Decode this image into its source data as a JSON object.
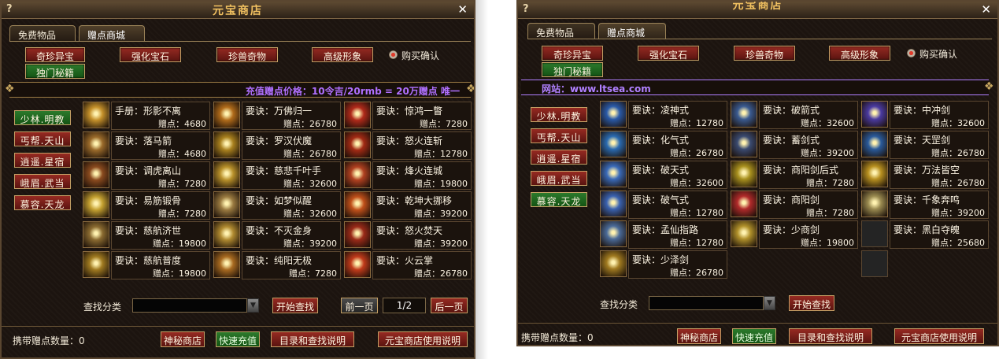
{
  "common": {
    "help_icon": "?",
    "close_icon": "✕",
    "title": "元宝商店",
    "tabs": [
      "免费物品",
      "赠点商城"
    ],
    "categories": [
      "奇珍异宝",
      "强化宝石",
      "珍兽奇物",
      "高级形象",
      "独门秘籍"
    ],
    "confirm_label": "购买确认",
    "sects": [
      "少林.明教",
      "丐帮.天山",
      "逍遥.星宿",
      "峨眉.武当",
      "慕容.天龙"
    ],
    "search_label": "查找分类",
    "search_value": "",
    "search_button": "开始查找",
    "carried_label": "携带赠点数量：0",
    "footer_buttons": [
      "神秘商店",
      "快速充值",
      "目录和查找说明",
      "元宝商店使用说明"
    ]
  },
  "left": {
    "banner": "充值赠点价格：10令吉/20rmb = 20万赠点  唯一",
    "active_sect_index": 0,
    "page_prev": "前一页",
    "page_indicator": "1/2",
    "page_next": "后一页",
    "items": [
      {
        "name": "手册：形影不离",
        "points": "赠点：4680",
        "icon_color": "#c4902a"
      },
      {
        "name": "要诀：万佛归一",
        "points": "赠点：26780",
        "icon_color": "#b06b1a"
      },
      {
        "name": "要诀：惊鸿一瞥",
        "points": "赠点：7280",
        "icon_color": "#b02a1a"
      },
      {
        "name": "要诀：落马箭",
        "points": "赠点：4680",
        "icon_color": "#9a6a2a"
      },
      {
        "name": "要诀：罗汉伏魔",
        "points": "赠点：26780",
        "icon_color": "#a8801e"
      },
      {
        "name": "要诀：怒火连斩",
        "points": "赠点：12780",
        "icon_color": "#a22a14"
      },
      {
        "name": "要诀：调虎离山",
        "points": "赠点：7280",
        "icon_color": "#8a4a1e"
      },
      {
        "name": "要诀：慈悲千叶手",
        "points": "赠点：32600",
        "icon_color": "#b8902a"
      },
      {
        "name": "要诀：烽火连城",
        "points": "赠点：19800",
        "icon_color": "#b04020"
      },
      {
        "name": "要诀：易筋锻骨",
        "points": "赠点：7280",
        "icon_color": "#c4a030"
      },
      {
        "name": "要诀：如梦似醒",
        "points": "赠点：32600",
        "icon_color": "#9a7a40"
      },
      {
        "name": "要诀：乾坤大挪移",
        "points": "赠点：39200",
        "icon_color": "#c0501a"
      },
      {
        "name": "要诀：慈航济世",
        "points": "赠点：19800",
        "icon_color": "#8a6a30"
      },
      {
        "name": "要诀：不灭金身",
        "points": "赠点：39200",
        "icon_color": "#b08a30"
      },
      {
        "name": "要诀：怒火焚天",
        "points": "赠点：39200",
        "icon_color": "#9a2a18"
      },
      {
        "name": "要诀：慈航普度",
        "points": "赠点：19800",
        "icon_color": "#a07a20"
      },
      {
        "name": "要诀：纯阳无极",
        "points": "赠点：7280",
        "icon_color": "#a86a20"
      },
      {
        "name": "要诀：火云掌",
        "points": "赠点：26780",
        "icon_color": "#c03a1a"
      }
    ]
  },
  "right": {
    "banner": "网站：www.ltsea.com",
    "active_sect_index": 4,
    "items": [
      {
        "name": "要诀：凌神式",
        "points": "赠点：12780",
        "icon_color": "#2a5aa8"
      },
      {
        "name": "要诀：破箭式",
        "points": "赠点：32600",
        "icon_color": "#3a5a90"
      },
      {
        "name": "要诀：中冲剑",
        "points": "赠点：32600",
        "icon_color": "#4a3aa0"
      },
      {
        "name": "要诀：化气式",
        "points": "赠点：26780",
        "icon_color": "#2a6ab0"
      },
      {
        "name": "要诀：蓄剑式",
        "points": "赠点：39200",
        "icon_color": "#3a4a70"
      },
      {
        "name": "要诀：天罡剑",
        "points": "赠点：26780",
        "icon_color": "#2a5a9a"
      },
      {
        "name": "要诀：破天式",
        "points": "赠点：32600",
        "icon_color": "#3a6ab8"
      },
      {
        "name": "要诀：商阳剑后式",
        "points": "赠点：7280",
        "icon_color": "#a8901e"
      },
      {
        "name": "要诀：万法皆空",
        "points": "赠点：26780",
        "icon_color": "#b89020"
      },
      {
        "name": "要诀：破气式",
        "points": "赠点：12780",
        "icon_color": "#3a62b0"
      },
      {
        "name": "要诀：商阳剑",
        "points": "赠点：7280",
        "icon_color": "#b02a2a"
      },
      {
        "name": "要诀：千象奔鸣",
        "points": "赠点：39200",
        "icon_color": "#9a8a50"
      },
      {
        "name": "要诀：孟仙指路",
        "points": "赠点：12780",
        "icon_color": "#4a6a98"
      },
      {
        "name": "要诀：少商剑",
        "points": "赠点：19800",
        "icon_color": "#b0902a"
      },
      {
        "name": "要诀：黑白夺魄",
        "points": "赠点：25680",
        "icon_color": "#3a72b0"
      },
      {
        "name": "要诀：少泽剑",
        "points": "赠点：26780",
        "icon_color": "#a07a20"
      }
    ]
  }
}
